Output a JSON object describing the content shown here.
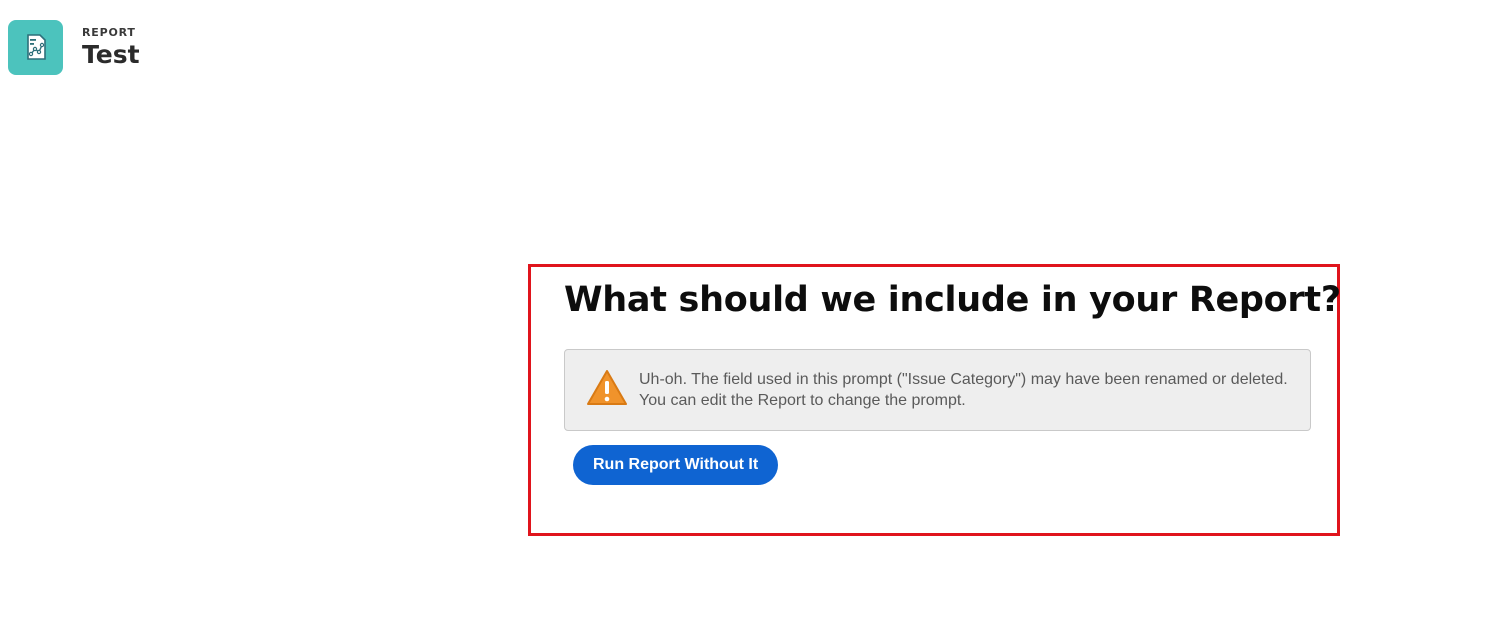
{
  "header": {
    "kicker": "REPORT",
    "title": "Test",
    "icon": "report-chart-icon",
    "icon_color": "#4cc3bd"
  },
  "prompt": {
    "heading": "What should we include in your Report?",
    "warning": {
      "icon": "warning-triangle-icon",
      "icon_color": "#f0932b",
      "message": "Uh-oh. The field used in this prompt (\"Issue Category\") may have been renamed or deleted. You can edit the Report to change the prompt."
    },
    "run_button_label": "Run Report Without It",
    "button_color": "#0f64d2",
    "frame_color": "#e0141c"
  }
}
